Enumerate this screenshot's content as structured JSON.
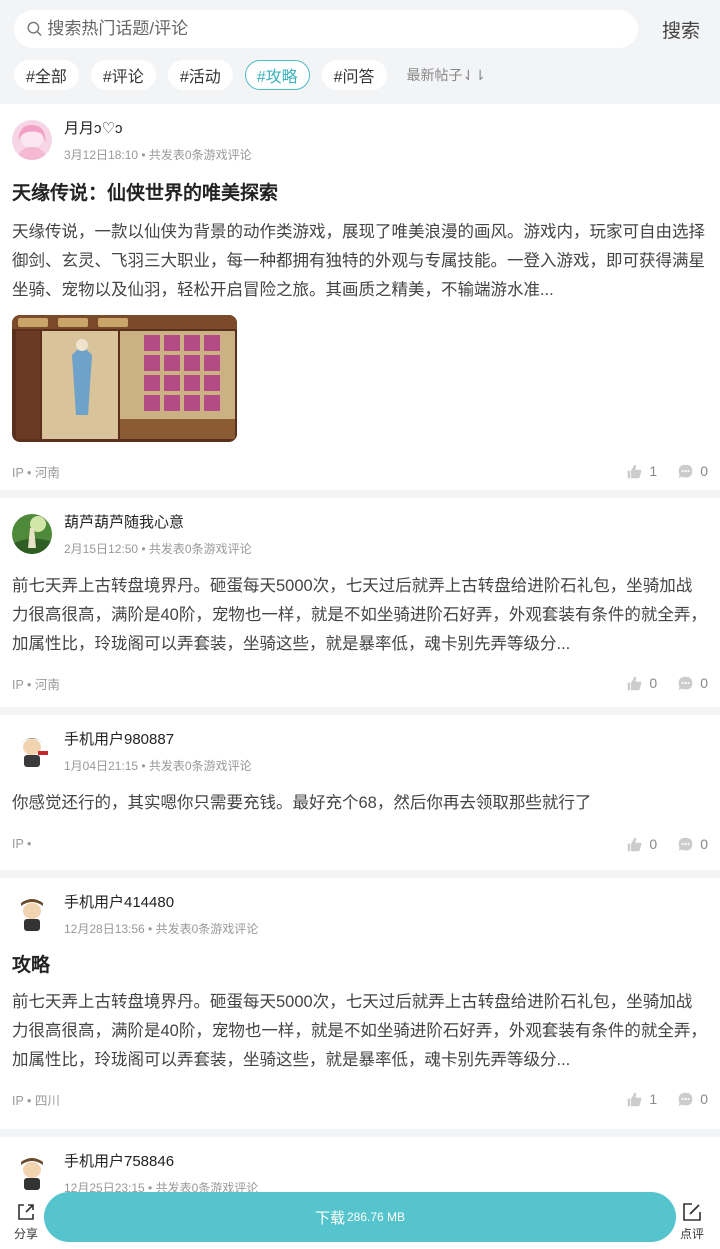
{
  "search": {
    "placeholder": "搜索热门话题/评论",
    "button": "搜索"
  },
  "tags": [
    "#全部",
    "#评论",
    "#活动",
    "#攻略",
    "#问答"
  ],
  "active_tag_index": 3,
  "sort_label": "最新帖子⇃⇂",
  "posts": [
    {
      "user": "月月ↄ♡ↄ",
      "meta": "3月12日18:10 • 共发表0条游戏评论",
      "title": "天缘传说：仙侠世界的唯美探索",
      "content": "天缘传说，一款以仙侠为背景的动作类游戏，展现了唯美浪漫的画风。游戏内，玩家可自由选择御剑、玄灵、飞羽三大职业，每一种都拥有独特的外观与专属技能。一登入游戏，即可获得满星坐骑、宠物以及仙羽，轻松开启冒险之旅。其画质之精美，不输端游水准...",
      "ip": "IP • 河南",
      "likes": "1",
      "comments": "0"
    },
    {
      "user": "葫芦葫芦随我心意",
      "meta": "2月15日12:50 • 共发表0条游戏评论",
      "content": "前七天弄上古转盘境界丹。砸蛋每天5000次，七天过后就弄上古转盘给进阶石礼包，坐骑加战力很高很高，满阶是40阶，宠物也一样，就是不如坐骑进阶石好弄，外观套装有条件的就全弄，加属性比，玲珑阁可以弄套装，坐骑这些，就是暴率低，魂卡别先弄等级分...",
      "ip": "IP • 河南",
      "likes": "0",
      "comments": "0"
    },
    {
      "user": "手机用户980887",
      "meta": "1月04日21:15 • 共发表0条游戏评论",
      "content": "你感觉还行的，其实嗯你只需要充钱。最好充个68，然后你再去领取那些就行了",
      "ip": "IP •",
      "likes": "0",
      "comments": "0"
    },
    {
      "user": "手机用户414480",
      "meta": "12月28日13:56 • 共发表0条游戏评论",
      "title": "攻略",
      "content": "前七天弄上古转盘境界丹。砸蛋每天5000次，七天过后就弄上古转盘给进阶石礼包，坐骑加战力很高很高，满阶是40阶，宠物也一样，就是不如坐骑进阶石好弄，外观套装有条件的就全弄，加属性比，玲珑阁可以弄套装，坐骑这些，就是暴率低，魂卡别先弄等级分...",
      "ip": "IP • 四川",
      "likes": "1",
      "comments": "0"
    },
    {
      "user": "手机用户758846",
      "meta": "12月25日23:15 • 共发表0条游戏评论"
    }
  ],
  "bottom": {
    "share": "分享",
    "download": "下载",
    "download_size": "286.76 MB",
    "comment": "点评"
  },
  "colors": {
    "accent": "#55c4cc",
    "tag_active": "#3cb2be"
  },
  "icons": [
    "search-icon",
    "like-icon",
    "comment-icon",
    "share-icon",
    "edit-icon"
  ]
}
